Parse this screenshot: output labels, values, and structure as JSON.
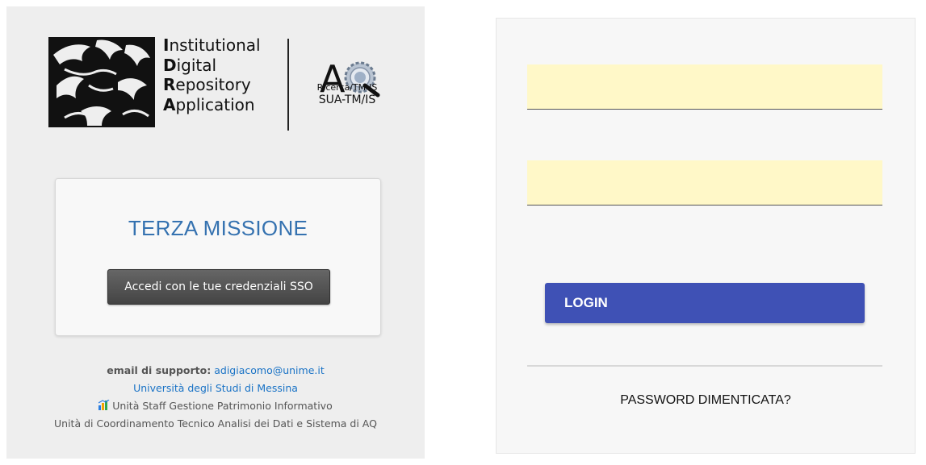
{
  "logo": {
    "idra_lines": [
      {
        "initial": "I",
        "rest": "nstitutional"
      },
      {
        "initial": "D",
        "rest": "igital"
      },
      {
        "initial": "R",
        "rest": "epository"
      },
      {
        "initial": "A",
        "rest": "pplication"
      }
    ],
    "aq_letter": "A",
    "aq_line1": "Ricerca/TM-IS",
    "aq_line2": "SUA-TM/IS"
  },
  "card": {
    "title": "TERZA MISSIONE",
    "sso_button": "Accedi con le tue credenziali SSO"
  },
  "footer": {
    "support_label": "email di supporto:",
    "support_email": "adigiacomo@unime.it",
    "university": "Università degli Studi di Messina",
    "staff_unit": "Unità Staff Gestione Patrimonio Informativo",
    "coord_unit": "Unità di Coordinamento Tecnico Analisi dei Dati e Sistema di AQ"
  },
  "login": {
    "username_value": "",
    "password_value": "",
    "login_button": "LOGIN",
    "forgot_password": "PASSWORD DIMENTICATA?"
  },
  "colors": {
    "accent": "#3f51b5",
    "title_blue": "#3572b0",
    "field_bg": "#fff8c8"
  }
}
